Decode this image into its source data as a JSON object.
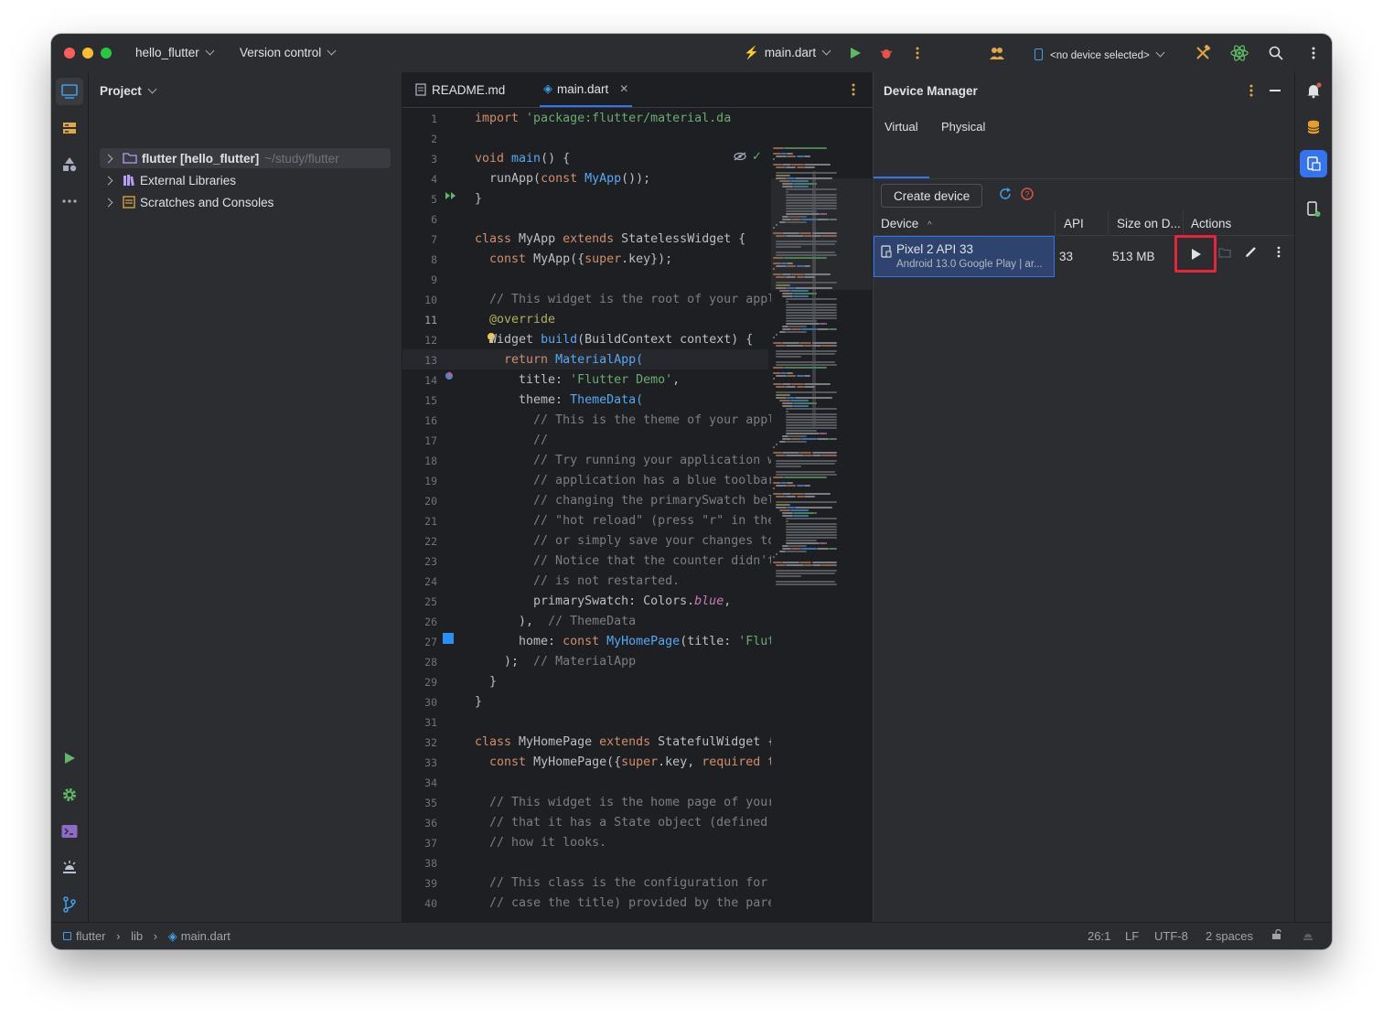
{
  "titlebar": {
    "project_name": "hello_flutter",
    "vcs_menu": "Version control",
    "run_config": "main.dart",
    "device_selector": "<no device selected>"
  },
  "project_panel": {
    "title": "Project",
    "items": [
      {
        "label": "flutter [hello_flutter]",
        "path": "~/study/flutter"
      },
      {
        "label": "External Libraries"
      },
      {
        "label": "Scratches and Consoles"
      }
    ]
  },
  "editor": {
    "tabs": [
      {
        "label": "README.md"
      },
      {
        "label": "main.dart"
      }
    ],
    "current_line": "11",
    "line_numbers": [
      "1",
      "2",
      "3",
      "4",
      "5",
      "6",
      "7",
      "8",
      "9",
      "10",
      "11",
      "12",
      "13",
      "14",
      "15",
      "16",
      "17",
      "18",
      "19",
      "20",
      "21",
      "22",
      "23",
      "24",
      "25",
      "26",
      "27",
      "28",
      "29",
      "30",
      "31",
      "32",
      "33",
      "34",
      "35",
      "36",
      "37",
      "38",
      "39",
      "40"
    ],
    "code_lines": [
      [
        {
          "t": "import ",
          "c": "kw"
        },
        {
          "t": "'package:flutter/material.da",
          "c": "str"
        }
      ],
      [],
      [
        {
          "t": "void ",
          "c": "kw"
        },
        {
          "t": "main",
          "c": "fn"
        },
        {
          "t": "() {",
          "c": ""
        }
      ],
      [
        {
          "t": "  runApp(",
          "c": ""
        },
        {
          "t": "const ",
          "c": "kw"
        },
        {
          "t": "MyApp",
          "c": "blue"
        },
        {
          "t": "());",
          "c": ""
        }
      ],
      [
        {
          "t": "}",
          "c": ""
        }
      ],
      [],
      [
        {
          "t": "class ",
          "c": "kw"
        },
        {
          "t": "MyApp ",
          "c": ""
        },
        {
          "t": "extends ",
          "c": "kw"
        },
        {
          "t": "StatelessWidget {",
          "c": ""
        }
      ],
      [
        {
          "t": "  ",
          "c": ""
        },
        {
          "t": "const ",
          "c": "kw"
        },
        {
          "t": "MyApp({",
          "c": ""
        },
        {
          "t": "super",
          "c": "kw"
        },
        {
          "t": ".key});",
          "c": ""
        }
      ],
      [],
      [
        {
          "t": "  // This widget is the root of your appl",
          "c": "cmt"
        }
      ],
      [
        {
          "t": "  ",
          "c": ""
        },
        {
          "t": "@override",
          "c": "ann"
        }
      ],
      [
        {
          "t": "  Widget ",
          "c": ""
        },
        {
          "t": "build",
          "c": "fn"
        },
        {
          "t": "(BuildContext context) {",
          "c": ""
        }
      ],
      [
        {
          "t": "    ",
          "c": ""
        },
        {
          "t": "return ",
          "c": "kw"
        },
        {
          "t": "MaterialApp(",
          "c": "blue"
        }
      ],
      [
        {
          "t": "      title: ",
          "c": ""
        },
        {
          "t": "'Flutter Demo'",
          "c": "str"
        },
        {
          "t": ",",
          "c": ""
        }
      ],
      [
        {
          "t": "      theme: ",
          "c": ""
        },
        {
          "t": "ThemeData(",
          "c": "blue"
        }
      ],
      [
        {
          "t": "        // This is the theme of your appl",
          "c": "cmt"
        }
      ],
      [
        {
          "t": "        //",
          "c": "cmt"
        }
      ],
      [
        {
          "t": "        // Try running your application w",
          "c": "cmt"
        }
      ],
      [
        {
          "t": "        // application has a blue toolbar",
          "c": "cmt"
        }
      ],
      [
        {
          "t": "        // changing the primarySwatch bel",
          "c": "cmt"
        }
      ],
      [
        {
          "t": "        // \"hot reload\" (press \"r\" in the",
          "c": "cmt"
        }
      ],
      [
        {
          "t": "        // or simply save your changes to",
          "c": "cmt"
        }
      ],
      [
        {
          "t": "        // Notice that the counter didn't",
          "c": "cmt"
        }
      ],
      [
        {
          "t": "        // is not restarted.",
          "c": "cmt"
        }
      ],
      [
        {
          "t": "        primarySwatch: Colors.",
          "c": ""
        },
        {
          "t": "blue",
          "c": "it"
        },
        {
          "t": ",",
          "c": ""
        }
      ],
      [
        {
          "t": "      ),  ",
          "c": ""
        },
        {
          "t": "// ThemeData",
          "c": "cmt"
        }
      ],
      [
        {
          "t": "      home: ",
          "c": ""
        },
        {
          "t": "const ",
          "c": "kw"
        },
        {
          "t": "MyHomePage",
          "c": "blue"
        },
        {
          "t": "(title: ",
          "c": ""
        },
        {
          "t": "'Flut",
          "c": "str"
        }
      ],
      [
        {
          "t": "    );  ",
          "c": ""
        },
        {
          "t": "// MaterialApp",
          "c": "cmt"
        }
      ],
      [
        {
          "t": "  }",
          "c": ""
        }
      ],
      [
        {
          "t": "}",
          "c": ""
        }
      ],
      [],
      [
        {
          "t": "class ",
          "c": "kw"
        },
        {
          "t": "MyHomePage ",
          "c": ""
        },
        {
          "t": "extends ",
          "c": "kw"
        },
        {
          "t": "StatefulWidget {",
          "c": ""
        }
      ],
      [
        {
          "t": "  ",
          "c": ""
        },
        {
          "t": "const ",
          "c": "kw"
        },
        {
          "t": "MyHomePage({",
          "c": ""
        },
        {
          "t": "super",
          "c": "kw"
        },
        {
          "t": ".key, ",
          "c": ""
        },
        {
          "t": "required t",
          "c": "kw"
        }
      ],
      [],
      [
        {
          "t": "  // This widget is the home page of your",
          "c": "cmt"
        }
      ],
      [
        {
          "t": "  // that it has a State object (defined",
          "c": "cmt"
        }
      ],
      [
        {
          "t": "  // how it looks.",
          "c": "cmt"
        }
      ],
      [],
      [
        {
          "t": "  // This class is the configuration for",
          "c": "cmt"
        }
      ],
      [
        {
          "t": "  // case the title) provided by the pare",
          "c": "cmt"
        }
      ]
    ]
  },
  "device_manager": {
    "title": "Device Manager",
    "tabs": [
      "Virtual",
      "Physical"
    ],
    "create_button": "Create device",
    "columns": [
      "Device",
      "API",
      "Size on D...",
      "Actions"
    ],
    "devices": [
      {
        "name": "Pixel 2 API 33",
        "subtitle": "Android 13.0 Google Play | ar...",
        "api": "33",
        "size": "513 MB"
      }
    ]
  },
  "statusbar": {
    "breadcrumb": [
      "flutter",
      "lib",
      "main.dart"
    ],
    "position": "26:1",
    "line_sep": "LF",
    "encoding": "UTF-8",
    "indent": "2 spaces"
  },
  "colors": {
    "accent": "#3574f0",
    "highlight_box": "#e8243b",
    "run_green": "#5fb865"
  }
}
